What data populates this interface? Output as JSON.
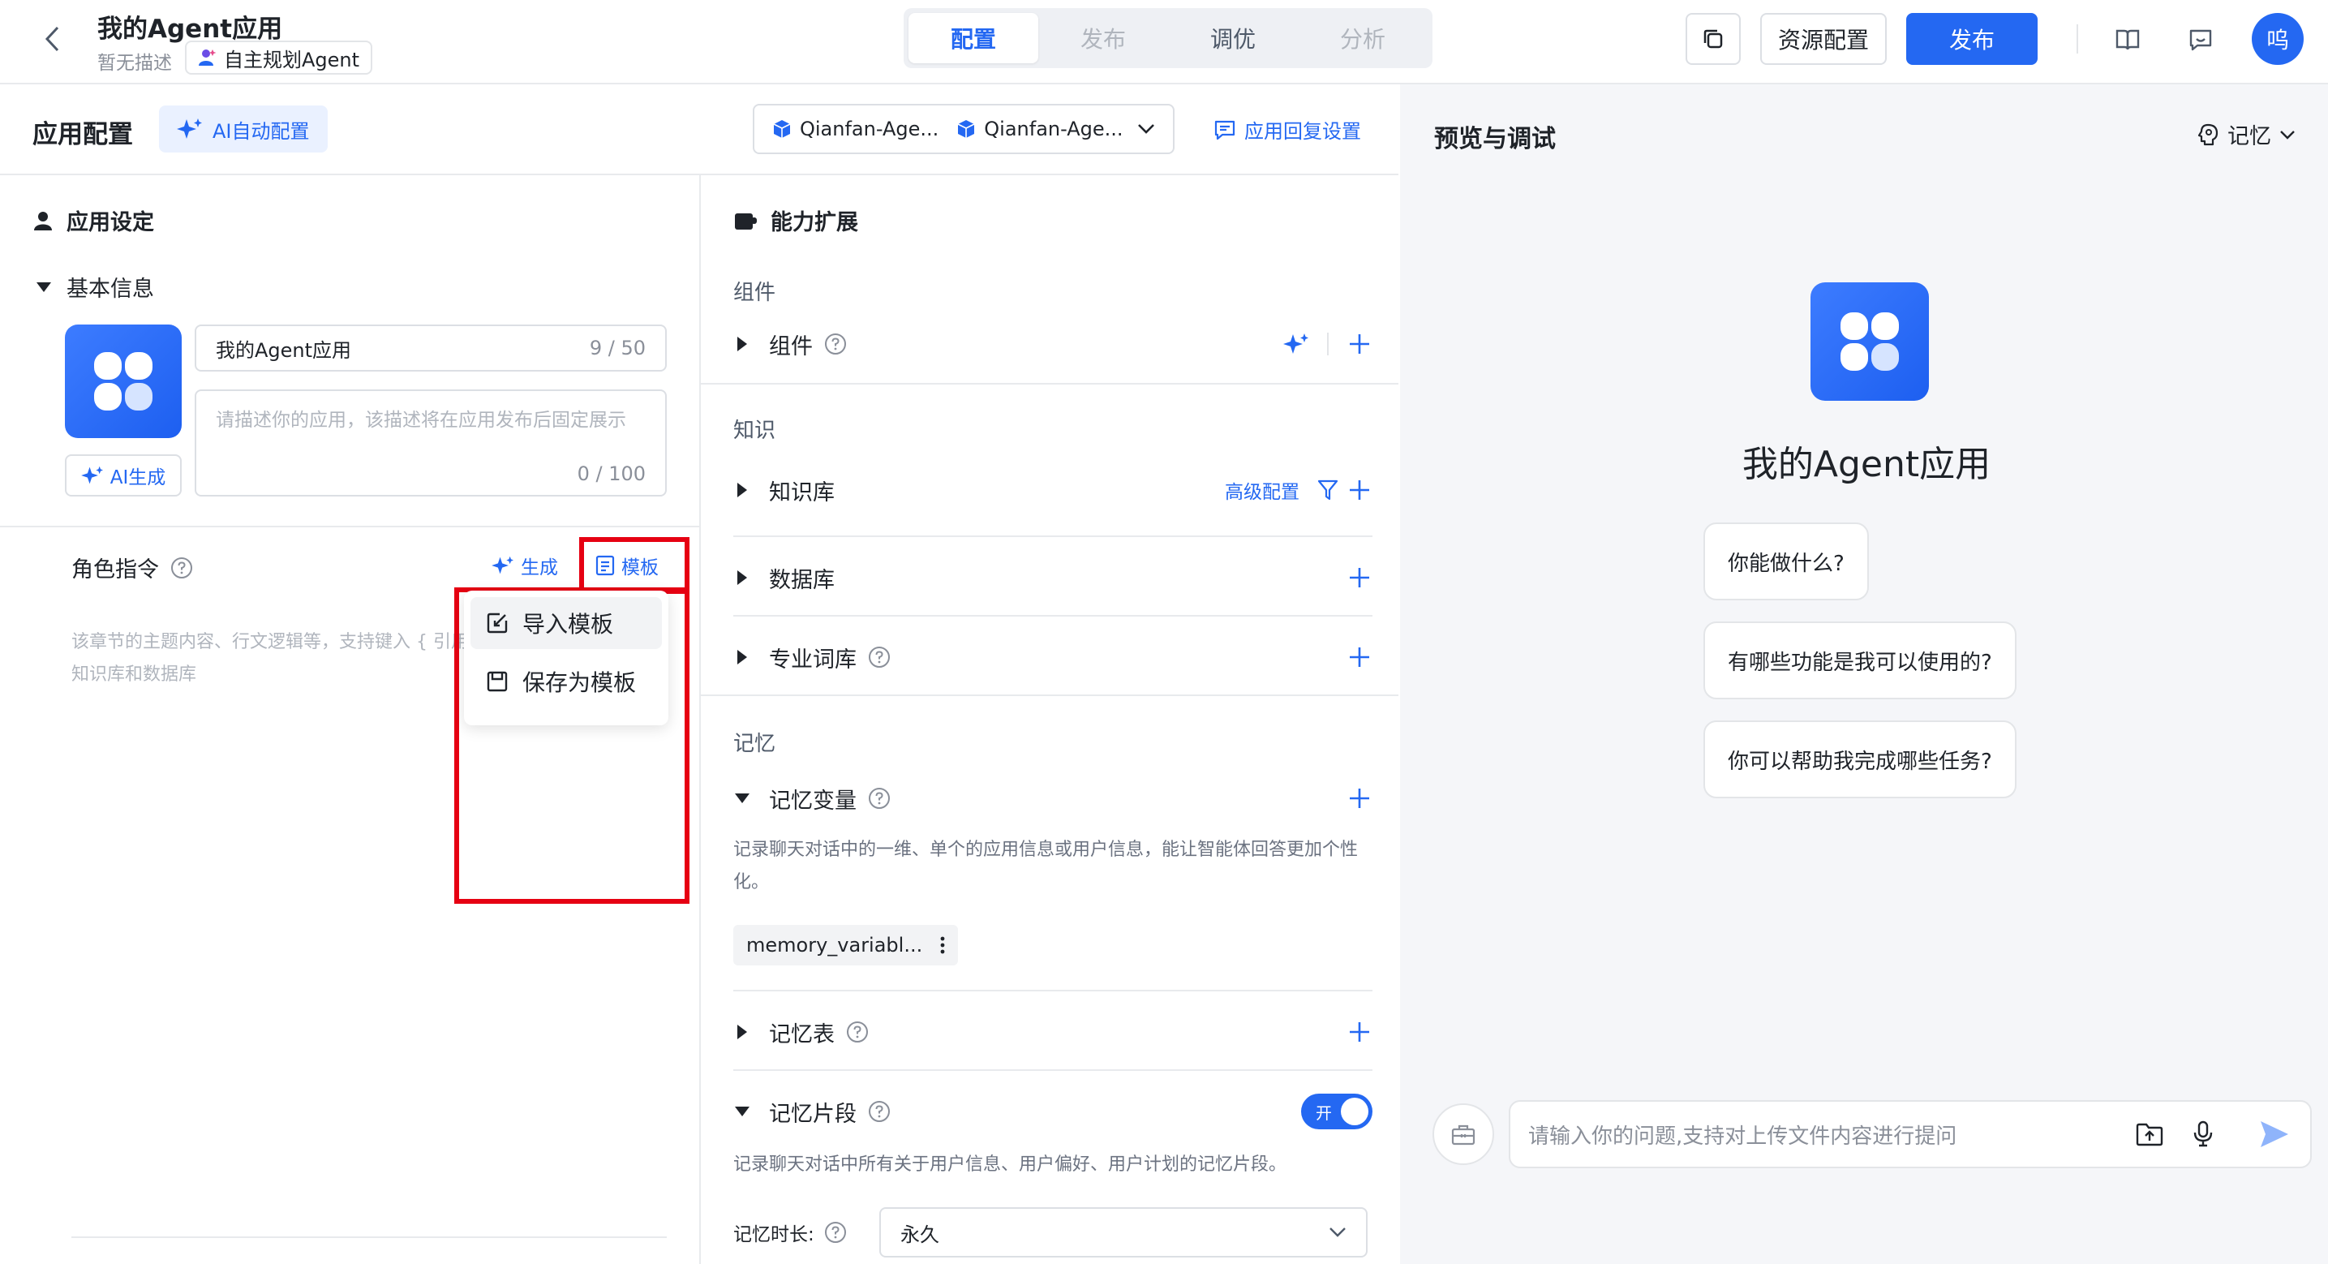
{
  "header": {
    "title": "我的Agent应用",
    "description": "暂无描述",
    "agent_type": "自主规划Agent",
    "tabs": [
      {
        "label": "配置",
        "active": true
      },
      {
        "label": "发布",
        "active": false
      },
      {
        "label": "调优",
        "active": false
      },
      {
        "label": "分析",
        "active": false
      }
    ],
    "resource_config_label": "资源配置",
    "publish_label": "发布",
    "avatar_text": "呜",
    "accent_color": "#2468f2"
  },
  "config": {
    "title": "应用配置",
    "ai_auto_label": "AI自动配置",
    "models": [
      "Qianfan-Age...",
      "Qianfan-Age..."
    ],
    "reply_settings_label": "应用回复设置"
  },
  "app_settings": {
    "section_title": "应用设定",
    "basic_info_label": "基本信息",
    "name_value": "我的Agent应用",
    "name_count": "9 / 50",
    "desc_placeholder": "请描述你的应用，该描述将在应用发布后固定展示",
    "desc_count": "0 / 100",
    "ai_generate_label": "AI生成",
    "role_label": "角色指令",
    "generate_label": "生成",
    "template_label": "模板",
    "role_placeholder": "该章节的主题内容、行文逻辑等，支持键入 { 引用知识库和数据库",
    "dropdown": {
      "import_label": "导入模板",
      "save_label": "保存为模板"
    }
  },
  "capabilities": {
    "section_title": "能力扩展",
    "components_group": "组件",
    "components_label": "组件",
    "knowledge_group": "知识",
    "kb_label": "知识库",
    "advanced_config_label": "高级配置",
    "database_label": "数据库",
    "glossary_label": "专业词库",
    "memory_group": "记忆",
    "memory_vars_label": "记忆变量",
    "memory_vars_desc": "记录聊天对话中的一维、单个的应用信息或用户信息，能让智能体回答更加个性化。",
    "memory_var_chip": "memory_variabl...",
    "memory_table_label": "记忆表",
    "memory_snippet_label": "记忆片段",
    "memory_snippet_on": true,
    "toggle_text": "开",
    "memory_snippet_desc": "记录聊天对话中所有关于用户信息、用户偏好、用户计划的记忆片段。",
    "duration_label": "记忆时长:",
    "duration_value": "永久"
  },
  "preview": {
    "title": "预览与调试",
    "memory_label": "记忆",
    "app_name": "我的Agent应用",
    "questions": [
      "你能做什么?",
      "有哪些功能是我可以使用的?",
      "你可以帮助我完成哪些任务?"
    ],
    "input_placeholder": "请输入你的问题,支持对上传文件内容进行提问"
  }
}
